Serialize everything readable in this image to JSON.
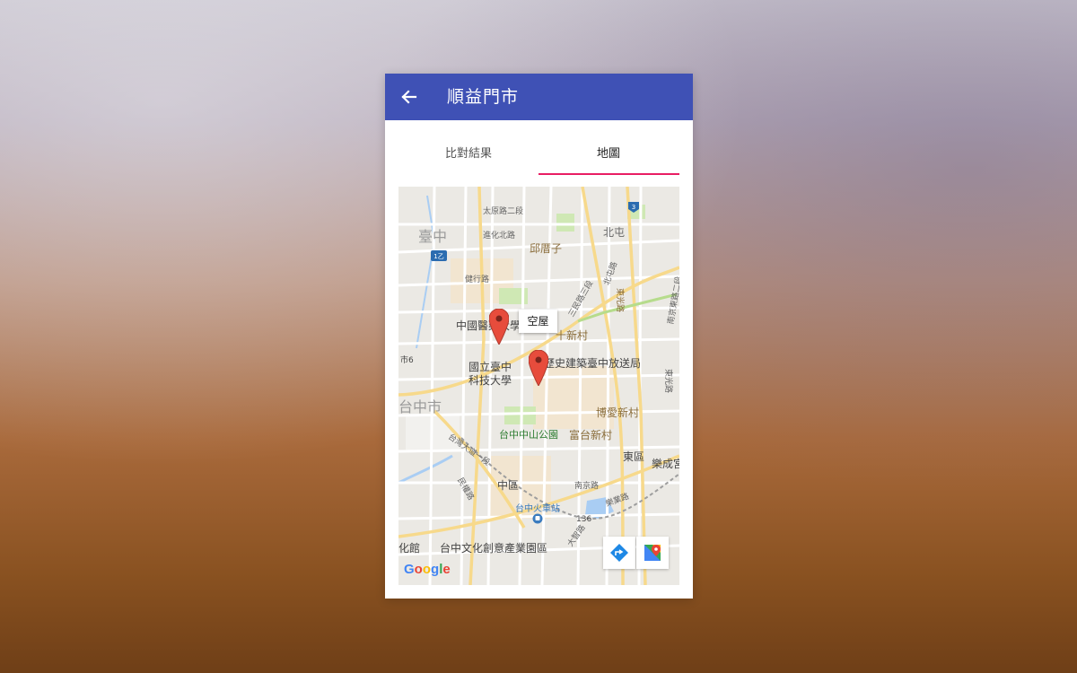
{
  "appbar": {
    "title": "順益門市",
    "back_icon": "arrow-back-icon",
    "color": "#3f51b5"
  },
  "tabs": [
    {
      "label": "比對結果",
      "active": false
    },
    {
      "label": "地圖",
      "active": true
    }
  ],
  "tab_indicator_color": "#e91e63",
  "map": {
    "large_labels": [
      "臺中",
      "台中市"
    ],
    "district_labels": [
      "邱厝子",
      "北屯",
      "十新村",
      "博愛新村",
      "富台新村"
    ],
    "poi_labels": [
      "中國醫藥大學",
      "國立臺中",
      "科技大學",
      "歷史建築臺中放送局",
      "中區",
      "東區",
      "樂成宮",
      "台中文化創意產業園區",
      "化館"
    ],
    "road_labels": [
      "太原路二段",
      "進化北路",
      "健行路",
      "三民路三段",
      "北屯路",
      "東光路",
      "台灣大道一段",
      "民權路",
      "南京路",
      "樂業路",
      "大智路",
      "南京東路二段",
      "東光路"
    ],
    "route_badges": [
      "3",
      "1乙",
      "市6",
      "136"
    ],
    "park_label": "台中中山公園",
    "station_label": "台中火車站",
    "marker_label": "空屋",
    "marker_count": 2,
    "marker_color": "#e74c3c",
    "attribution": "Google",
    "controls": {
      "directions_icon": "directions-icon",
      "open_maps_icon": "google-maps-icon"
    }
  }
}
